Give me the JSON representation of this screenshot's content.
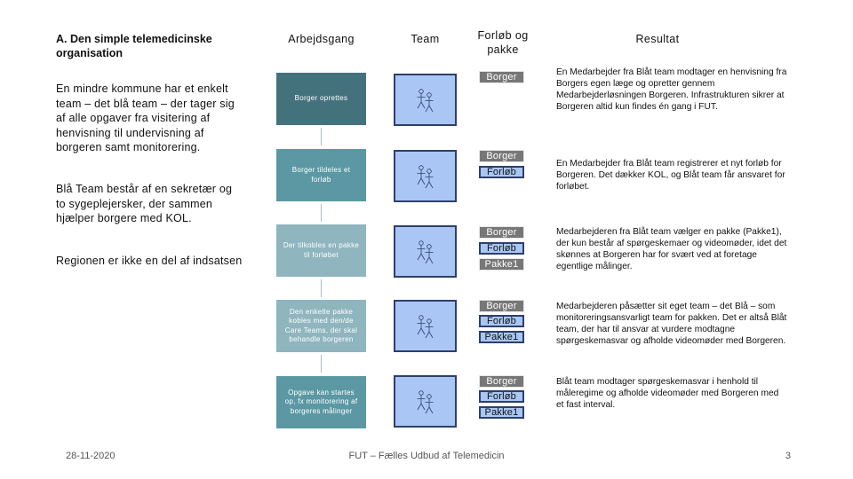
{
  "left": {
    "title": "A. Den simple telemedicinske organisation",
    "paragraphs": [
      "En mindre kommune har et enkelt team – det blå team – der tager sig af alle opgaver fra visitering af henvisning til undervisning af borgeren samt monitorering.",
      "Blå Team består af en sekretær og to sygeplejersker, der sammen hjælper borgere med KOL.",
      "Regionen er ikke en del af indsatsen"
    ]
  },
  "headers": {
    "workflow": "Arbejdsgang",
    "team": "Team",
    "course": "Forløb og pakke",
    "result": "Resultat"
  },
  "icons": {
    "team": "two-people-stick-figures-icon"
  },
  "colors": {
    "workflow_dark": "#43727d",
    "workflow_mid": "#5b98a4",
    "workflow_light": "#8fb5bf",
    "team_fill": "#a9c6f5",
    "team_border": "#2e3f6a",
    "tag_gray": "#777777"
  },
  "rows": [
    {
      "workflow": "Borger oprettes",
      "tags": [
        "Borger"
      ],
      "result": "En Medarbejder fra Blåt team modtager en henvisning fra Borgers egen læge og opretter gennem Medarbejderløsningen Borgeren. Infrastrukturen sikrer at Borgeren altid kun findes én gang i FUT."
    },
    {
      "workflow": "Borger tildeles et forløb",
      "tags": [
        "Borger",
        "Forløb"
      ],
      "result": "En Medarbejder fra Blåt team registrerer et nyt forløb for Borgeren. Det dækker KOL, og Blåt team får ansvaret for forløbet."
    },
    {
      "workflow": "Der tilkobles en pakke til forløbet",
      "tags": [
        "Borger",
        "Forløb",
        "Pakke1"
      ],
      "result": "Medarbejderen fra Blåt team vælger en pakke (Pakke1), der kun består af spørgeskemaer og videomøder, idet det skønnes at Borgeren har for svært ved at foretage egentlige målinger."
    },
    {
      "workflow": "Den enkelte pakke kobles med den/de Care Teams, der skal behandle borgeren",
      "tags": [
        "Borger",
        "Forløb",
        "Pakke1"
      ],
      "result": "Medarbejderen påsætter sit eget team – det Blå – som monitoreringsansvarligt team for pakken. Det er altså Blåt team, der har til ansvar at vurdere modtagne spørgeskemasvar og afholde videomøder med Borgeren."
    },
    {
      "workflow": "Opgave kan startes op, fx monitorering af borgeres målinger",
      "tags": [
        "Borger",
        "Forløb",
        "Pakke1"
      ],
      "result": "Blåt team modtager spørgeskemasvar i henhold til måleregime og afholde videomøder med Borgeren med et fast interval."
    }
  ],
  "footer": {
    "date": "28-11-2020",
    "center": "FUT – Fælles Udbud af Telemedicin",
    "page": "3"
  }
}
